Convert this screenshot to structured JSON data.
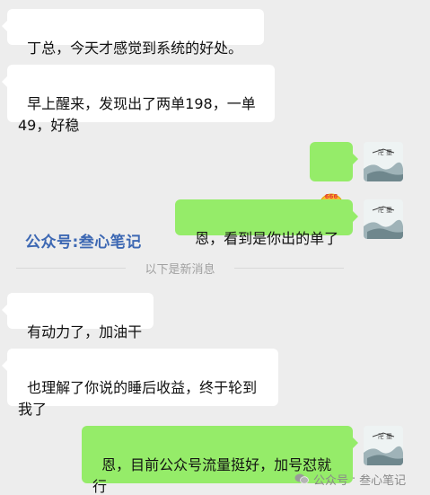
{
  "messages": [
    {
      "id": "m1",
      "side": "incoming",
      "text": "丁总，今天才感觉到系统的好处。"
    },
    {
      "id": "m2",
      "side": "incoming",
      "text": "早上醒来，发现出了两单198，一单49，好稳"
    },
    {
      "id": "m3",
      "side": "outgoing",
      "type": "emoji",
      "emoji_name": "666-thumbs-emoji"
    },
    {
      "id": "m4",
      "side": "outgoing",
      "text": "恩，看到是你出的单了"
    },
    {
      "id": "m5",
      "side": "incoming",
      "text": "有动力了，加油干"
    },
    {
      "id": "m6",
      "side": "incoming",
      "text": "也理解了你说的睡后收益，终于轮到我了"
    },
    {
      "id": "m7",
      "side": "outgoing",
      "text": "恩，目前公众号流量挺好，加号怼就行"
    }
  ],
  "divider": {
    "text": "以下是新消息"
  },
  "watermark": {
    "blue_text": "公众号:叁心笔记",
    "footer_source": "公众号",
    "footer_sep": "·",
    "footer_name": "叁心笔记"
  },
  "emoji_badge": "666",
  "colors": {
    "background": "#ededed",
    "incoming_bubble": "#ffffff",
    "outgoing_bubble": "#95ec69",
    "watermark_blue": "#3d68b3"
  }
}
